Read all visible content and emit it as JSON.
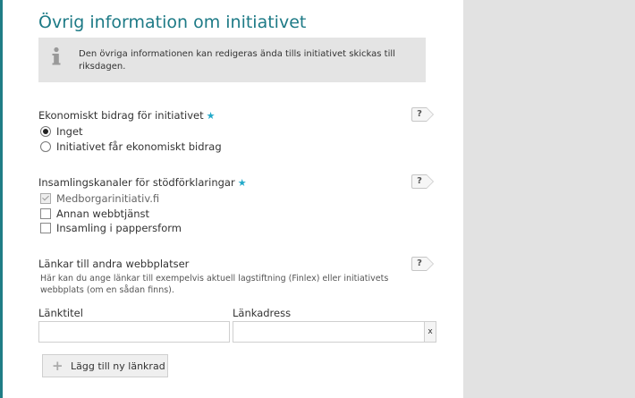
{
  "section_title": "Övrig information om initiativet",
  "info": {
    "icon": "info-icon",
    "text": "Den övriga informationen kan redigeras ända tills initiativet skickas till riksdagen."
  },
  "required_marker": "★",
  "help_label": "?",
  "economic_support": {
    "label": "Ekonomiskt bidrag för initiativet",
    "options": [
      {
        "label": "Inget",
        "selected": true
      },
      {
        "label": "Initiativet får ekonomiskt bidrag",
        "selected": false
      }
    ]
  },
  "collection_channels": {
    "label": "Insamlingskanaler för stödförklaringar",
    "options": [
      {
        "label": "Medborgarinitiativ.fi",
        "checked": true,
        "disabled": true
      },
      {
        "label": "Annan webbtjänst",
        "checked": false
      },
      {
        "label": "Insamling i pappersform",
        "checked": false
      }
    ]
  },
  "links": {
    "label": "Länkar till andra webbplatser",
    "description": "Här kan du ange länkar till exempelvis aktuell lagstiftning (Finlex) eller initiativets webbplats (om en sådan finns).",
    "title_label": "Länktitel",
    "address_label": "Länkadress",
    "title_value": "",
    "address_value": "",
    "clear_label": "x",
    "add_button": "Lägg till ny länkrad"
  },
  "colors": {
    "accent": "#1d7a86",
    "star": "#22a9c9",
    "info_bg": "#e4e4e4"
  }
}
